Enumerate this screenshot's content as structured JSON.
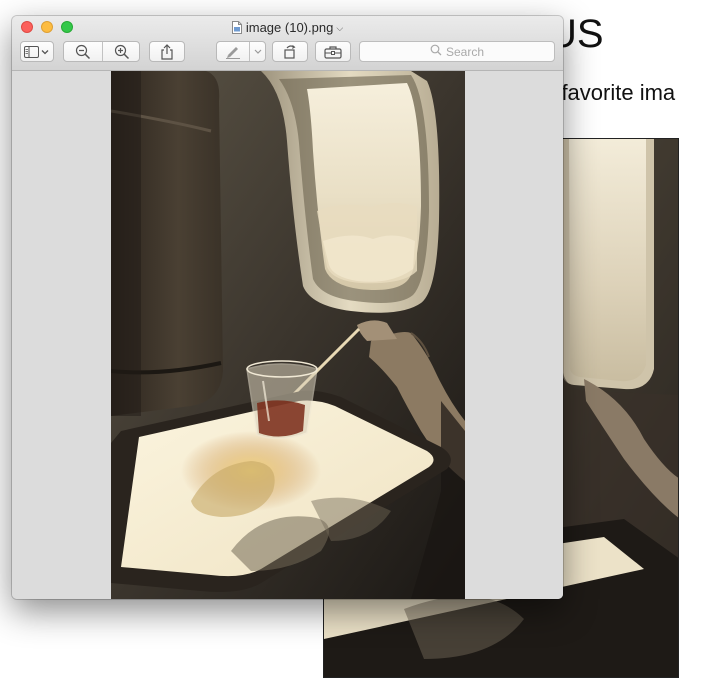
{
  "background_page": {
    "heading_fragment": "US",
    "subtitle_fragment": "r favorite ima"
  },
  "window": {
    "title": "image (10).png",
    "traffic_lights": [
      "close",
      "minimize",
      "maximize"
    ],
    "toolbar": {
      "sidebar_button_icon": "sidebar-icon",
      "zoom_out_icon": "zoom-out-icon",
      "zoom_in_icon": "zoom-in-icon",
      "share_icon": "share-icon",
      "markup_icon": "pen-icon",
      "rotate_icon": "rotate-icon",
      "toolbox_icon": "toolbox-icon"
    },
    "search": {
      "placeholder": "Search"
    }
  },
  "photo": {
    "description_icon": "airplane-window-drink-photo"
  },
  "colors": {
    "close": "#fc605b",
    "minimize": "#fdbc40",
    "maximize": "#34c84a",
    "window_bg": "#dcdcdc"
  }
}
